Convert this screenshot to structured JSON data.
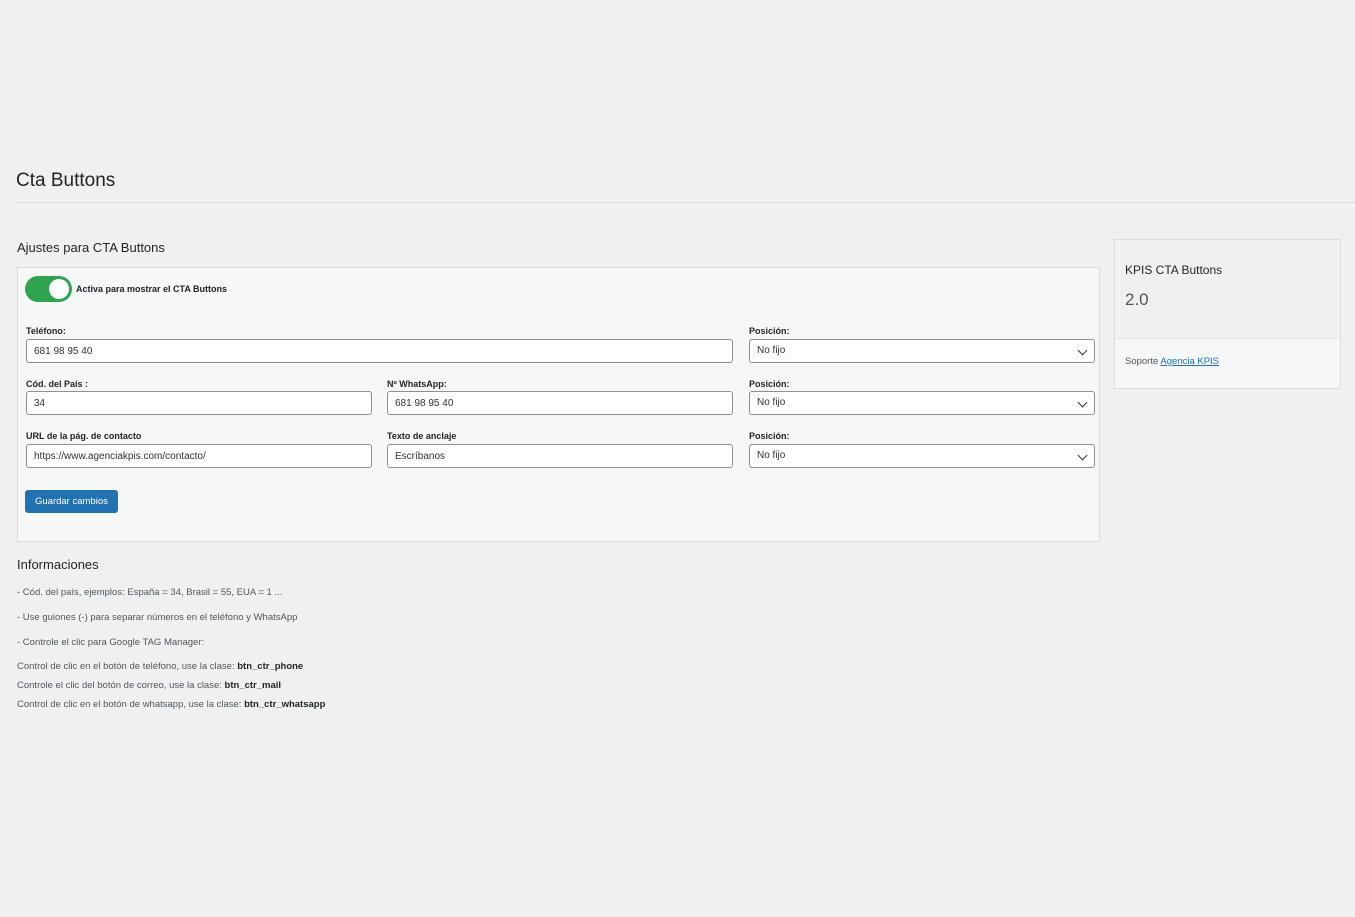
{
  "page": {
    "title": "Cta Buttons"
  },
  "settings": {
    "section_title": "Ajustes para CTA Buttons",
    "toggle": {
      "label": "Activa para mostrar el CTA Buttons",
      "on": true
    },
    "phone": {
      "label": "Teléfono:",
      "value": "681 98 95 40"
    },
    "phone_position": {
      "label": "Posición:",
      "value": "No fijo"
    },
    "country_code": {
      "label": "Cód. del País :",
      "value": "34"
    },
    "whatsapp": {
      "label": "Nº WhatsApp:",
      "value": "681 98 95 40"
    },
    "whatsapp_position": {
      "label": "Posición:",
      "value": "No fijo"
    },
    "contact_url": {
      "label": "URL de la pág. de contacto",
      "value": "https://www.agenciakpis.com/contacto/"
    },
    "anchor_text": {
      "label": "Texto de anclaje",
      "value": "Escríbanos"
    },
    "contact_position": {
      "label": "Posición:",
      "value": "No fijo"
    },
    "save_label": "Guardar cambios"
  },
  "info": {
    "title": "Informaciones",
    "line1": "- Cód. del país, ejemplos: España = 34, Brasil = 55, EUA = 1 ...",
    "line2": "- Use guiones (-) para separar números en el teléfono y WhatsApp",
    "line3": "- Controle el clic para Google TAG Manager:",
    "line4_text": "Control de clic en el botón de teléfono, use la clase: ",
    "line4_class": "btn_ctr_phone",
    "line5_text": "Controle el clic del botón de correo, use la clase: ",
    "line5_class": "btn_ctr_mail",
    "line6_text": "Control de clic en el botón de whatsapp, use la clase: ",
    "line6_class": "btn_ctr_whatsapp"
  },
  "sidebar": {
    "title": "KPIS CTA Buttons",
    "version": "2.0",
    "support_text": "Soporte ",
    "support_link": "Agencia KPIS"
  },
  "colors": {
    "toggle_on": "#2ea44f",
    "primary_button": "#2271b1",
    "background": "#f0f0f1"
  }
}
